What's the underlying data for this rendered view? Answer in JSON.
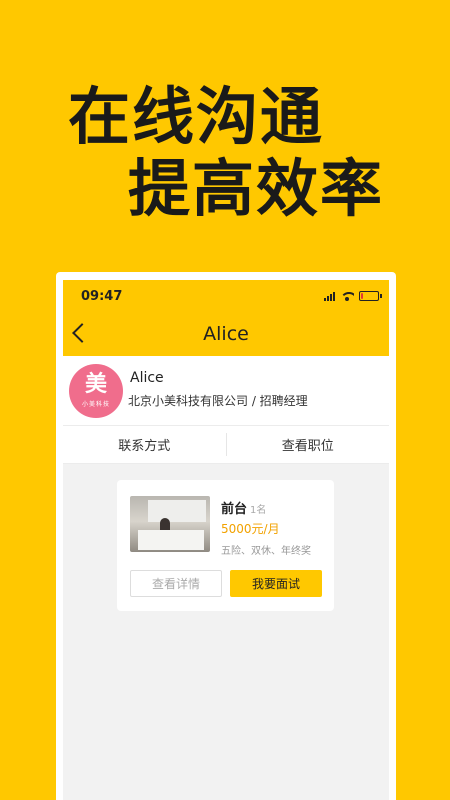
{
  "headline": {
    "line1": "在线沟通",
    "line2": "提高效率"
  },
  "status_bar": {
    "time": "09:47",
    "battery_level": 0.15
  },
  "nav": {
    "title": "Alice"
  },
  "profile": {
    "avatar_glyph": "美",
    "avatar_sub": "小美科技",
    "name": "Alice",
    "company_role": "北京小美科技有限公司 / 招聘经理"
  },
  "actions": {
    "contact": "联系方式",
    "view_job": "查看职位"
  },
  "job": {
    "title": "前台",
    "count": "1名",
    "salary": "5000元/月",
    "benefits": "五险、双休、年终奖",
    "detail_label": "查看详情",
    "interview_label": "我要面试"
  },
  "colors": {
    "brand_yellow": "#FFC800",
    "salary_orange": "#f2a200",
    "avatar_pink": "#f06d8c"
  }
}
